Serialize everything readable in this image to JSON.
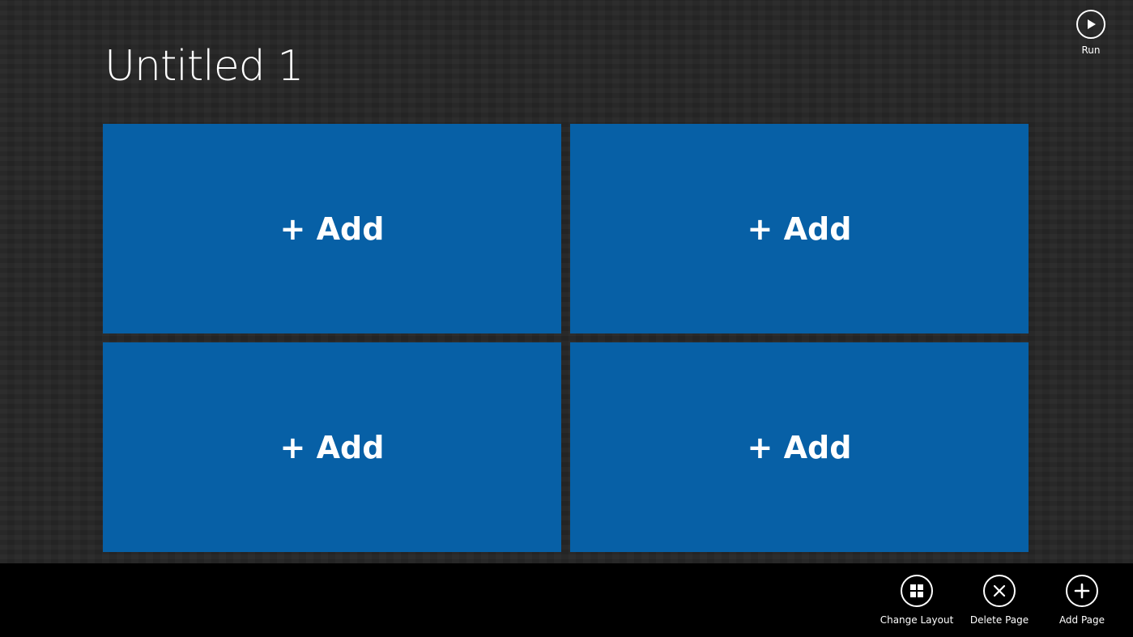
{
  "document": {
    "title": "Untitled 1"
  },
  "top_bar": {
    "run_label": "Run",
    "run_icon": "play-icon"
  },
  "tiles": [
    {
      "label": "+ Add"
    },
    {
      "label": "+ Add"
    },
    {
      "label": "+ Add"
    },
    {
      "label": "+ Add"
    }
  ],
  "app_bar": {
    "buttons": [
      {
        "label": "Change Layout",
        "icon": "grid-layout-icon"
      },
      {
        "label": "Delete Page",
        "icon": "close-icon"
      },
      {
        "label": "Add Page",
        "icon": "plus-icon"
      }
    ]
  },
  "colors": {
    "background": "#262626",
    "tile": "#0760a6",
    "app_bar": "#000000",
    "text": "#ffffff"
  }
}
